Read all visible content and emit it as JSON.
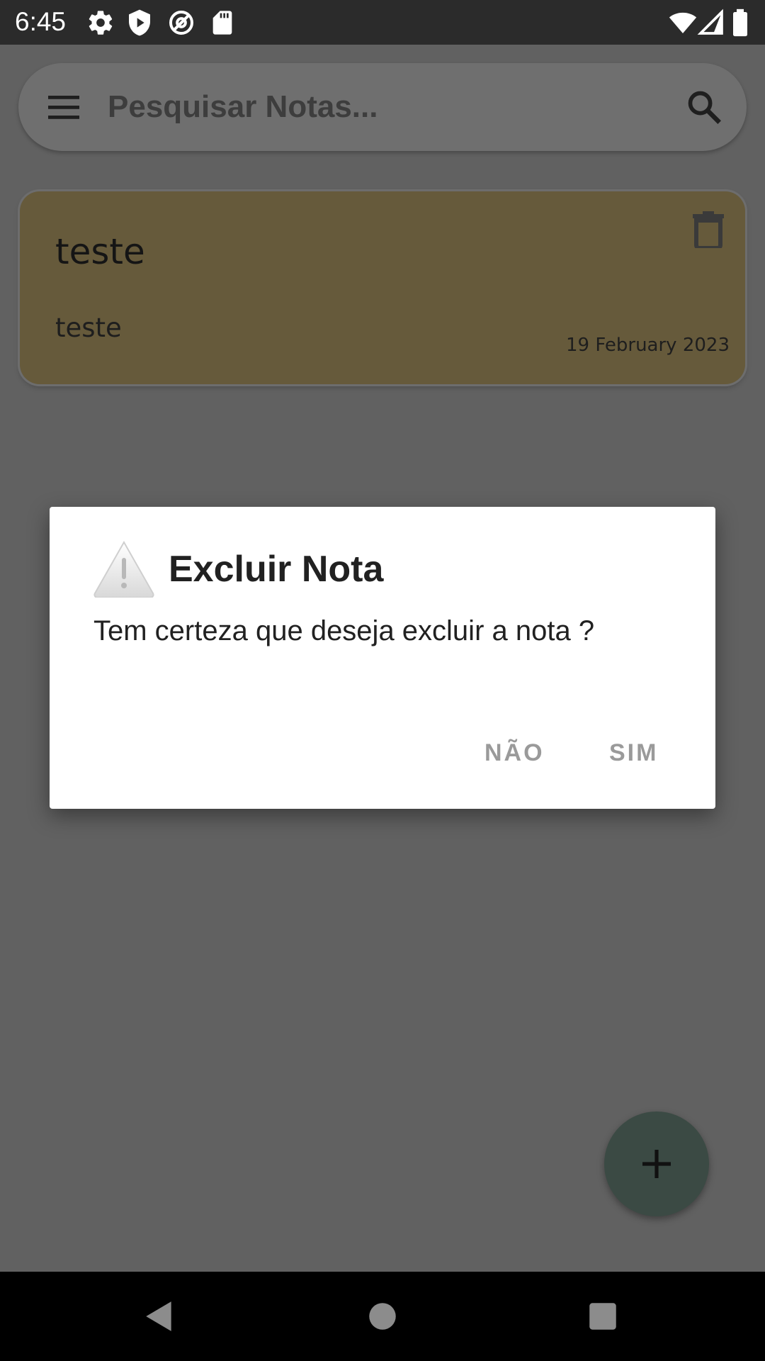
{
  "status_bar": {
    "time": "6:45",
    "left_icons": [
      "gear-icon",
      "shield-play-icon",
      "at-sync-icon",
      "sd-card-icon"
    ],
    "right_icons": [
      "wifi-icon",
      "cell-signal-icon",
      "battery-icon"
    ]
  },
  "search": {
    "placeholder": "Pesquisar Notas...",
    "menu_icon": "hamburger-menu-icon",
    "search_icon": "magnifier-icon"
  },
  "notes": [
    {
      "title": "teste",
      "body": "teste",
      "date": "19 February 2023",
      "color": "#665a3b",
      "delete_icon": "trash-icon"
    }
  ],
  "fab": {
    "icon": "plus-icon"
  },
  "dialog": {
    "icon": "warning-icon",
    "title": "Excluir Nota",
    "message": "Tem certeza que deseja excluir a nota ?",
    "negative_label": "NÃO",
    "positive_label": "SIM"
  },
  "nav_bar": {
    "back_icon": "back-triangle-icon",
    "home_icon": "home-circle-icon",
    "recents_icon": "recents-square-icon"
  },
  "colors": {
    "scrim_background": "#616161",
    "status_bar": "#2b2b2b",
    "note_card": "#665a3b",
    "dialog_button_text": "#9a9a9a",
    "fab": "#3b4a44"
  }
}
